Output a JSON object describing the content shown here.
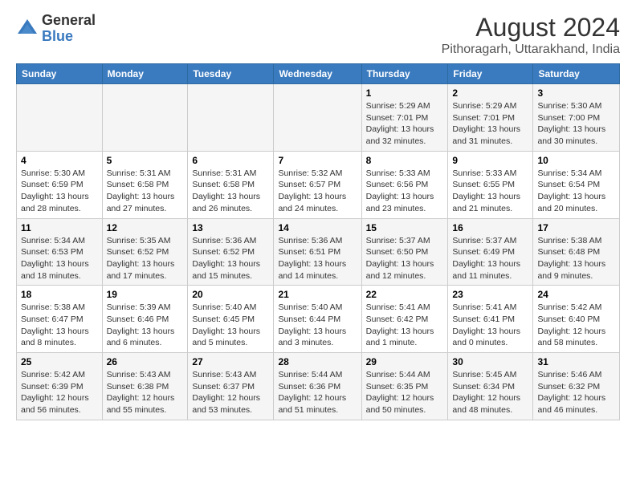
{
  "header": {
    "logo_general": "General",
    "logo_blue": "Blue",
    "month_year": "August 2024",
    "location": "Pithoragarh, Uttarakhand, India"
  },
  "days_of_week": [
    "Sunday",
    "Monday",
    "Tuesday",
    "Wednesday",
    "Thursday",
    "Friday",
    "Saturday"
  ],
  "weeks": [
    [
      {
        "day": "",
        "info": ""
      },
      {
        "day": "",
        "info": ""
      },
      {
        "day": "",
        "info": ""
      },
      {
        "day": "",
        "info": ""
      },
      {
        "day": "1",
        "info": "Sunrise: 5:29 AM\nSunset: 7:01 PM\nDaylight: 13 hours\nand 32 minutes."
      },
      {
        "day": "2",
        "info": "Sunrise: 5:29 AM\nSunset: 7:01 PM\nDaylight: 13 hours\nand 31 minutes."
      },
      {
        "day": "3",
        "info": "Sunrise: 5:30 AM\nSunset: 7:00 PM\nDaylight: 13 hours\nand 30 minutes."
      }
    ],
    [
      {
        "day": "4",
        "info": "Sunrise: 5:30 AM\nSunset: 6:59 PM\nDaylight: 13 hours\nand 28 minutes."
      },
      {
        "day": "5",
        "info": "Sunrise: 5:31 AM\nSunset: 6:58 PM\nDaylight: 13 hours\nand 27 minutes."
      },
      {
        "day": "6",
        "info": "Sunrise: 5:31 AM\nSunset: 6:58 PM\nDaylight: 13 hours\nand 26 minutes."
      },
      {
        "day": "7",
        "info": "Sunrise: 5:32 AM\nSunset: 6:57 PM\nDaylight: 13 hours\nand 24 minutes."
      },
      {
        "day": "8",
        "info": "Sunrise: 5:33 AM\nSunset: 6:56 PM\nDaylight: 13 hours\nand 23 minutes."
      },
      {
        "day": "9",
        "info": "Sunrise: 5:33 AM\nSunset: 6:55 PM\nDaylight: 13 hours\nand 21 minutes."
      },
      {
        "day": "10",
        "info": "Sunrise: 5:34 AM\nSunset: 6:54 PM\nDaylight: 13 hours\nand 20 minutes."
      }
    ],
    [
      {
        "day": "11",
        "info": "Sunrise: 5:34 AM\nSunset: 6:53 PM\nDaylight: 13 hours\nand 18 minutes."
      },
      {
        "day": "12",
        "info": "Sunrise: 5:35 AM\nSunset: 6:52 PM\nDaylight: 13 hours\nand 17 minutes."
      },
      {
        "day": "13",
        "info": "Sunrise: 5:36 AM\nSunset: 6:52 PM\nDaylight: 13 hours\nand 15 minutes."
      },
      {
        "day": "14",
        "info": "Sunrise: 5:36 AM\nSunset: 6:51 PM\nDaylight: 13 hours\nand 14 minutes."
      },
      {
        "day": "15",
        "info": "Sunrise: 5:37 AM\nSunset: 6:50 PM\nDaylight: 13 hours\nand 12 minutes."
      },
      {
        "day": "16",
        "info": "Sunrise: 5:37 AM\nSunset: 6:49 PM\nDaylight: 13 hours\nand 11 minutes."
      },
      {
        "day": "17",
        "info": "Sunrise: 5:38 AM\nSunset: 6:48 PM\nDaylight: 13 hours\nand 9 minutes."
      }
    ],
    [
      {
        "day": "18",
        "info": "Sunrise: 5:38 AM\nSunset: 6:47 PM\nDaylight: 13 hours\nand 8 minutes."
      },
      {
        "day": "19",
        "info": "Sunrise: 5:39 AM\nSunset: 6:46 PM\nDaylight: 13 hours\nand 6 minutes."
      },
      {
        "day": "20",
        "info": "Sunrise: 5:40 AM\nSunset: 6:45 PM\nDaylight: 13 hours\nand 5 minutes."
      },
      {
        "day": "21",
        "info": "Sunrise: 5:40 AM\nSunset: 6:44 PM\nDaylight: 13 hours\nand 3 minutes."
      },
      {
        "day": "22",
        "info": "Sunrise: 5:41 AM\nSunset: 6:42 PM\nDaylight: 13 hours\nand 1 minute."
      },
      {
        "day": "23",
        "info": "Sunrise: 5:41 AM\nSunset: 6:41 PM\nDaylight: 13 hours\nand 0 minutes."
      },
      {
        "day": "24",
        "info": "Sunrise: 5:42 AM\nSunset: 6:40 PM\nDaylight: 12 hours\nand 58 minutes."
      }
    ],
    [
      {
        "day": "25",
        "info": "Sunrise: 5:42 AM\nSunset: 6:39 PM\nDaylight: 12 hours\nand 56 minutes."
      },
      {
        "day": "26",
        "info": "Sunrise: 5:43 AM\nSunset: 6:38 PM\nDaylight: 12 hours\nand 55 minutes."
      },
      {
        "day": "27",
        "info": "Sunrise: 5:43 AM\nSunset: 6:37 PM\nDaylight: 12 hours\nand 53 minutes."
      },
      {
        "day": "28",
        "info": "Sunrise: 5:44 AM\nSunset: 6:36 PM\nDaylight: 12 hours\nand 51 minutes."
      },
      {
        "day": "29",
        "info": "Sunrise: 5:44 AM\nSunset: 6:35 PM\nDaylight: 12 hours\nand 50 minutes."
      },
      {
        "day": "30",
        "info": "Sunrise: 5:45 AM\nSunset: 6:34 PM\nDaylight: 12 hours\nand 48 minutes."
      },
      {
        "day": "31",
        "info": "Sunrise: 5:46 AM\nSunset: 6:32 PM\nDaylight: 12 hours\nand 46 minutes."
      }
    ]
  ]
}
